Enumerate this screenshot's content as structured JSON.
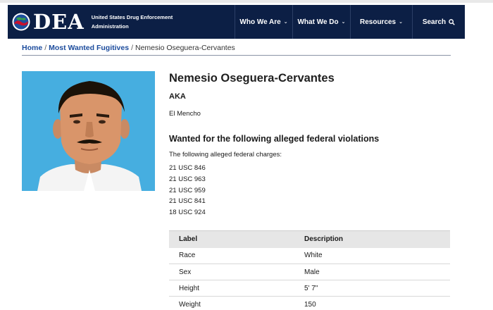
{
  "header": {
    "brand": "DEA",
    "agency_line1": "United States Drug Enforcement",
    "agency_line2": "Administration",
    "nav": [
      {
        "label": "Who We Are",
        "icon": "chevron-down-icon"
      },
      {
        "label": "What We Do",
        "icon": "chevron-down-icon"
      },
      {
        "label": "Resources",
        "icon": "chevron-down-icon"
      },
      {
        "label": "Search",
        "icon": "search-icon"
      }
    ],
    "colors": {
      "bar": "#0c1f45",
      "text": "#ffffff"
    }
  },
  "breadcrumb": {
    "home": "Home",
    "section": "Most Wanted Fugitives",
    "current": "Nemesio Oseguera-Cervantes",
    "separator": "/"
  },
  "profile": {
    "name": "Nemesio Oseguera-Cervantes",
    "aka_label": "AKA",
    "aka_value": "El Mencho",
    "wanted_heading": "Wanted for the following alleged federal violations",
    "charges_intro": "The following alleged federal charges:",
    "charges": [
      "21 USC 846",
      "21 USC 963",
      "21 USC 959",
      "21 USC 841",
      "18 USC 924"
    ],
    "photo_background": "#46aee0"
  },
  "details_table": {
    "headers": [
      "Label",
      "Description"
    ],
    "rows": [
      {
        "label": "Race",
        "value": "White"
      },
      {
        "label": "Sex",
        "value": "Male"
      },
      {
        "label": "Height",
        "value": "5' 7\""
      },
      {
        "label": "Weight",
        "value": "150"
      }
    ]
  }
}
